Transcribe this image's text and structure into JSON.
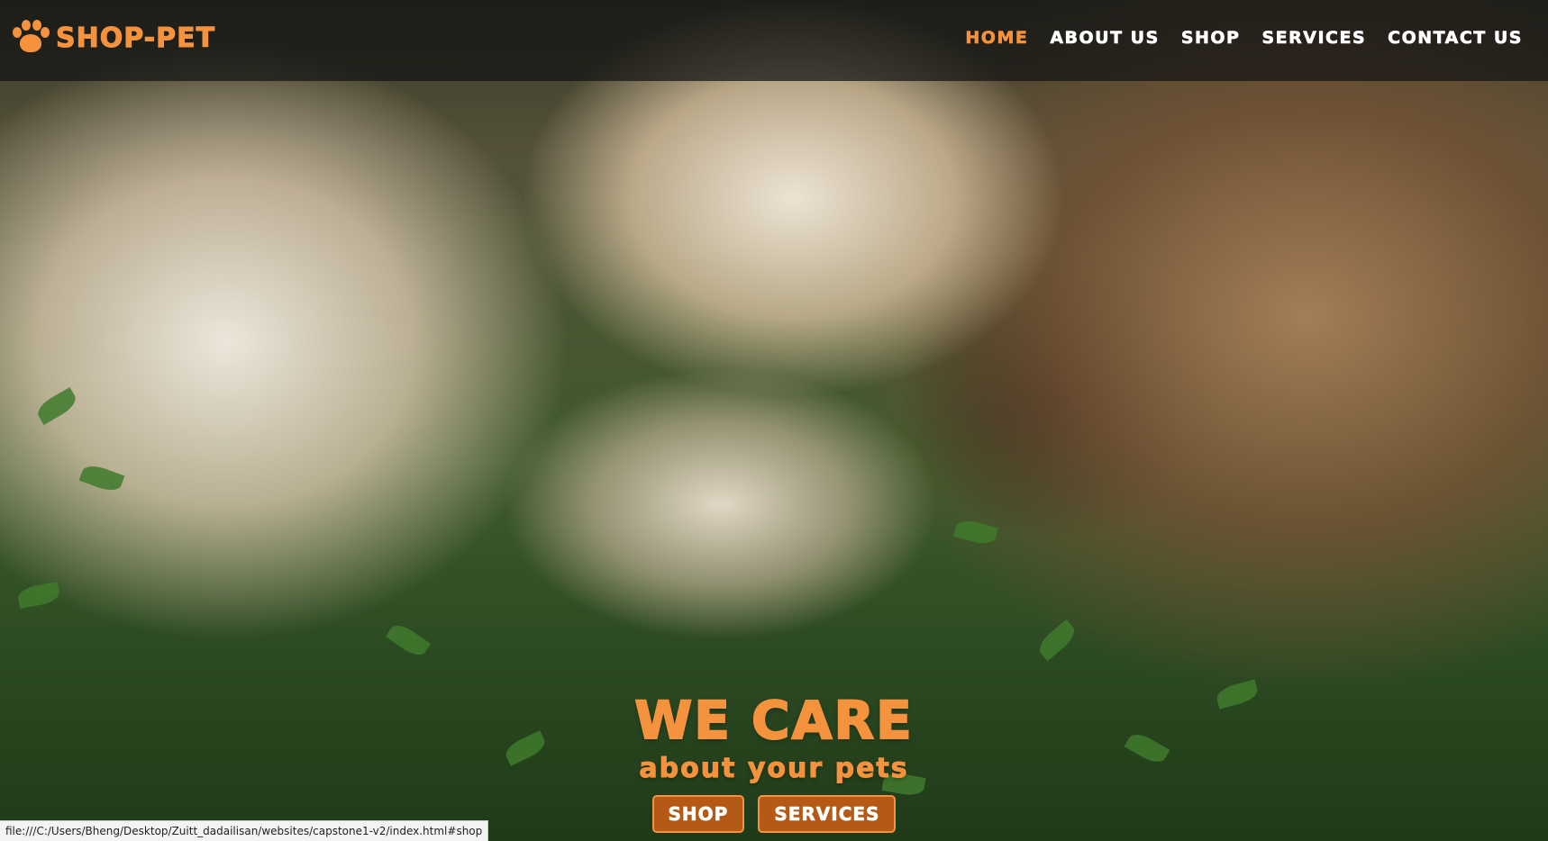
{
  "brand": {
    "name": "SHOP-PET",
    "icon": "paw-icon",
    "color": "#f5923e"
  },
  "nav": {
    "items": [
      {
        "label": "HOME",
        "active": true
      },
      {
        "label": "ABOUT US",
        "active": false
      },
      {
        "label": "SHOP",
        "active": false
      },
      {
        "label": "SERVICES",
        "active": false
      },
      {
        "label": "CONTACT US",
        "active": false
      }
    ]
  },
  "hero": {
    "image": "cat and dog lying on grass",
    "title": "WE CARE",
    "subtitle": "about your pets",
    "buttons": [
      {
        "label": "SHOP"
      },
      {
        "label": "SERVICES"
      }
    ]
  },
  "status_bar": {
    "url": "file:///C:/Users/Bheng/Desktop/Zuitt_dadailisan/websites/capstone1-v2/index.html#shop"
  },
  "colors": {
    "accent": "#f5923e",
    "button_bg": "#b45a16",
    "nav_bg": "rgba(20,20,20,0.72)"
  }
}
